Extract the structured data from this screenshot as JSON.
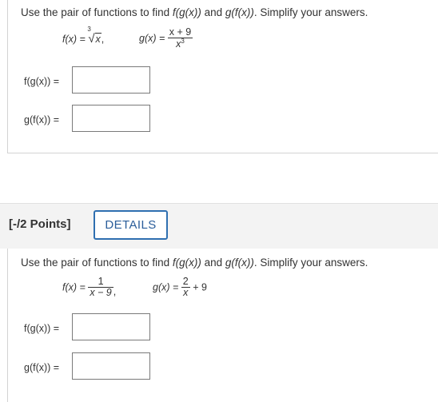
{
  "question1": {
    "instruction_prefix": "Use the pair of functions to find ",
    "fg": "f(g(x))",
    "and": " and ",
    "gf": "g(f(x))",
    "instruction_suffix": ". Simplify your answers.",
    "f_lhs": "f(x) =",
    "f_root_index": "3",
    "f_root_symbol": "√",
    "f_radicand": "x",
    "f_comma": ",",
    "g_lhs": "g(x) =",
    "g_numerator": "x + 9",
    "g_denominator_base": "x",
    "g_denominator_exp": "3",
    "fg_label": "f(g(x)) =",
    "gf_label": "g(f(x)) =",
    "fg_value": "",
    "gf_value": ""
  },
  "question2": {
    "points_label": "[-/2 Points]",
    "details_label": "DETAILS",
    "instruction_prefix": "Use the pair of functions to find ",
    "fg": "f(g(x))",
    "and": " and ",
    "gf": "g(f(x))",
    "instruction_suffix": ". Simplify your answers.",
    "f_lhs": "f(x) =",
    "f_numerator": "1",
    "f_denominator": "x − 9",
    "f_comma": ",",
    "g_lhs": "g(x) =",
    "g_numerator": "2",
    "g_denominator": "x",
    "g_tail": "+ 9",
    "fg_label": "f(g(x)) =",
    "gf_label": "g(f(x)) =",
    "fg_value": "",
    "gf_value": ""
  }
}
